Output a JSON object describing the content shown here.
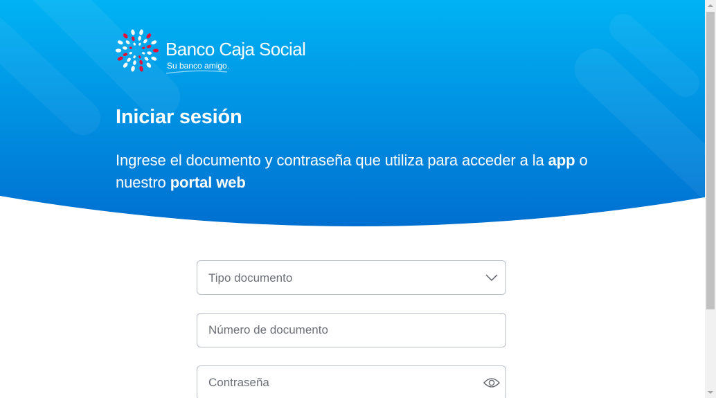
{
  "brand": {
    "name": "Banco Caja Social",
    "tagline": "Su banco amigo.",
    "colors": {
      "hero_top": "#00b3f4",
      "hero_bottom": "#006fd0",
      "logo_red": "#e2133a",
      "logo_white": "#ffffff"
    }
  },
  "header": {
    "title": "Iniciar sesión",
    "subtitle_part1": "Ingrese el documento y contraseña que utiliza para acceder a la ",
    "subtitle_bold1": "app",
    "subtitle_part2": " o nuestro ",
    "subtitle_bold2": "portal web"
  },
  "form": {
    "doc_type": {
      "placeholder": "Tipo documento",
      "icon": "chevron-down-icon"
    },
    "doc_number": {
      "placeholder": "Número de documento",
      "value": ""
    },
    "password": {
      "placeholder": "Contraseña",
      "value": "",
      "icon": "eye-icon"
    }
  }
}
